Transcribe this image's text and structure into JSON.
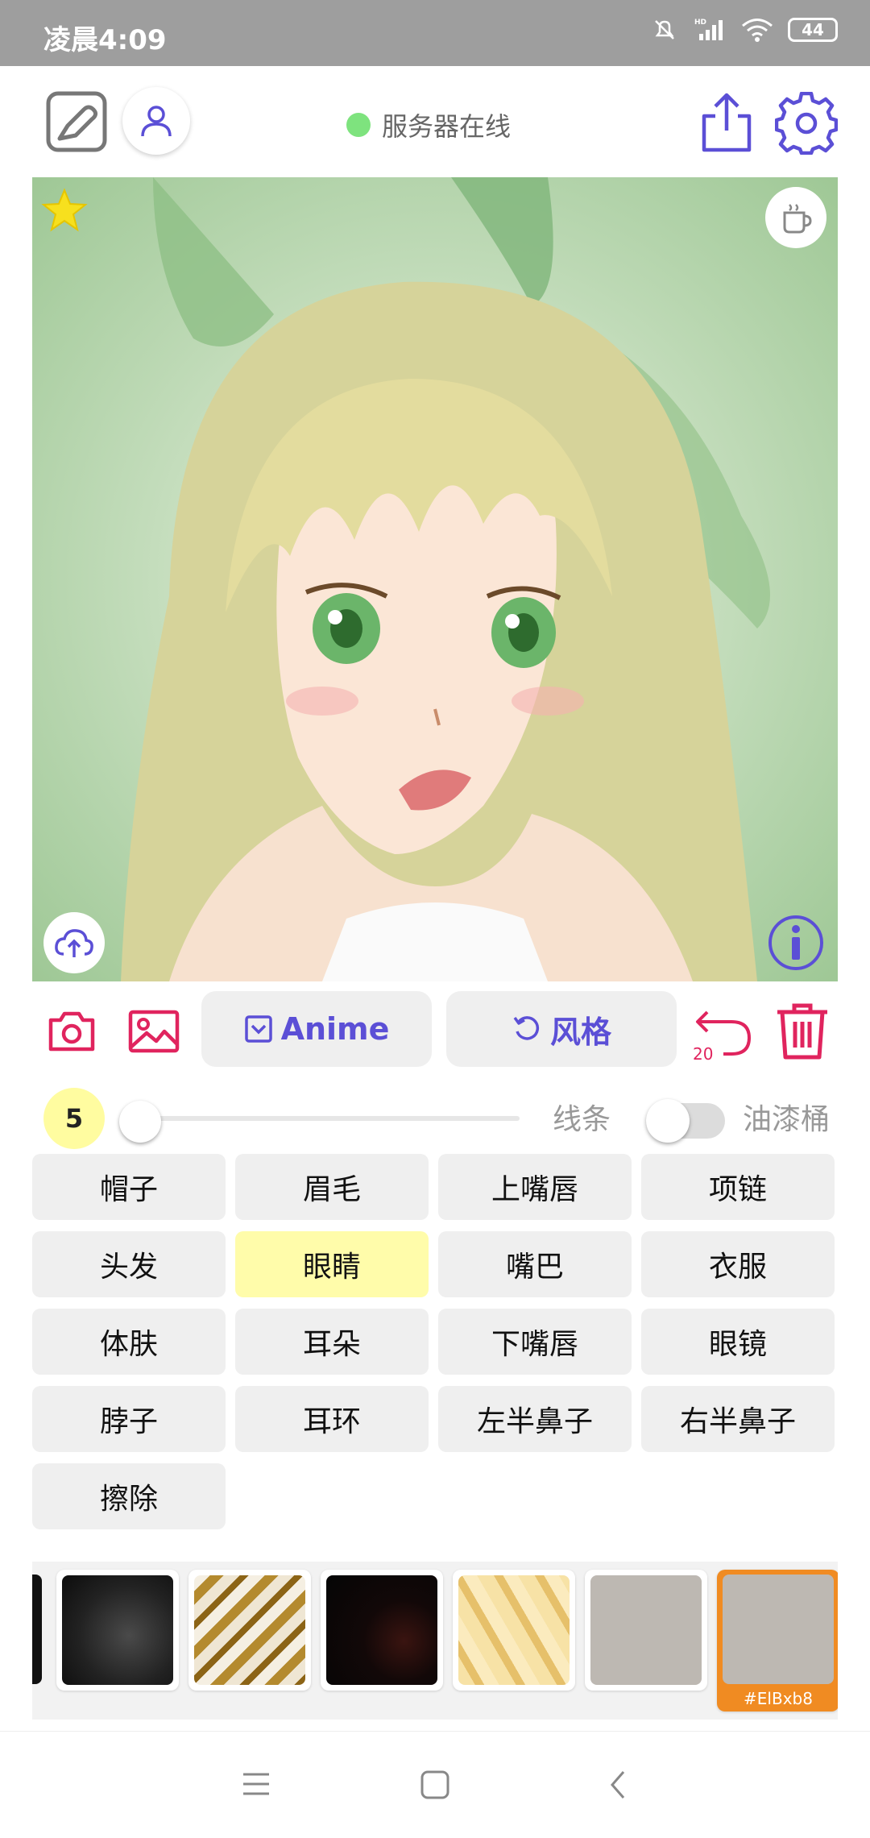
{
  "status_bar": {
    "time": "凌晨4:09",
    "battery": "44"
  },
  "header": {
    "server_status": "服务器在线"
  },
  "canvas": {
    "favorite": true
  },
  "toolbar": {
    "anime_label": "Anime",
    "style_label": "风格",
    "undo_count": "20"
  },
  "slider": {
    "size_value": "5",
    "lines_label": "线条",
    "bucket_label": "油漆桶"
  },
  "segments": [
    "帽子",
    "眉毛",
    "上嘴唇",
    "项链",
    "头发",
    "眼睛",
    "嘴巴",
    "衣服",
    "体肤",
    "耳朵",
    "下嘴唇",
    "眼镜",
    "脖子",
    "耳环",
    "左半鼻子",
    "右半鼻子",
    "擦除"
  ],
  "selected_segment": "眼睛",
  "textures": {
    "selected_code": "#ElBxb8"
  },
  "colors": {
    "accent": "#5b4fd6",
    "danger": "#e0245e",
    "server_online": "#7ee37e",
    "selected_cell": "#fffcaa",
    "selected_swatch": "#f08b22"
  }
}
